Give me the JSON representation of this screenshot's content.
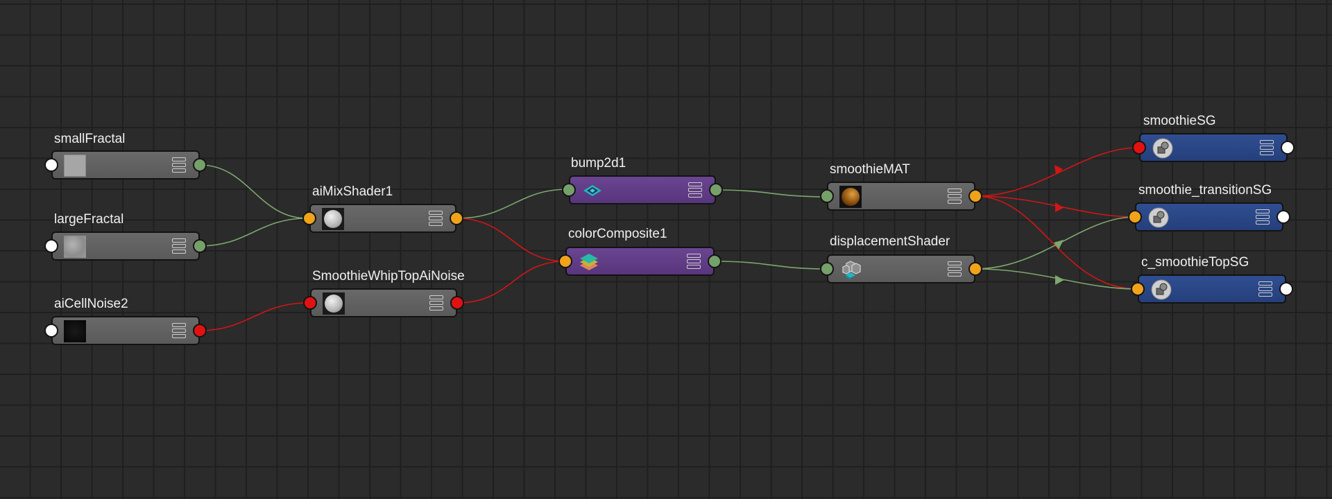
{
  "nodes": {
    "smallFractal": {
      "name": "smallFractal",
      "thumbnail": "fractal-thumbnail-light"
    },
    "largeFractal": {
      "name": "largeFractal",
      "thumbnail": "fractal-thumbnail-cloud"
    },
    "aiCellNoise2": {
      "name": "aiCellNoise2",
      "thumbnail": "cellnoise-thumbnail-dark"
    },
    "aiMixShader1": {
      "name": "aiMixShader1",
      "thumbnail": "sphere-thumbnail"
    },
    "smoothieWhipTopAiNoise": {
      "name": "SmoothieWhipTopAiNoise",
      "thumbnail": "sphere-thumbnail"
    },
    "bump2d1": {
      "name": "bump2d1",
      "icon": "bump-icon"
    },
    "colorComposite1": {
      "name": "colorComposite1",
      "icon": "layers-icon"
    },
    "smoothieMAT": {
      "name": "smoothieMAT",
      "thumbnail": "material-sphere-thumbnail"
    },
    "displacementShader": {
      "name": "displacementShader",
      "icon": "displacement-icon"
    },
    "smoothieSG": {
      "name": "smoothieSG",
      "icon": "shading-group-icon"
    },
    "smoothieTransitionSG": {
      "name": "smoothie_transitionSG",
      "icon": "shading-group-icon"
    },
    "cSmoothieTopSG": {
      "name": "c_smoothieTopSG",
      "icon": "shading-group-icon"
    }
  },
  "colors": {
    "background": "#2b2b2b",
    "grid": "#1f1f1f",
    "node_gray": "#636363",
    "node_purple": "#5f3c86",
    "node_blue": "#2a4787",
    "port_green": "#76a06a",
    "port_orange": "#f0a31a",
    "port_red": "#e21212",
    "port_white": "#ffffff",
    "wire_green": "#7ea86f",
    "wire_red": "#d41515"
  }
}
